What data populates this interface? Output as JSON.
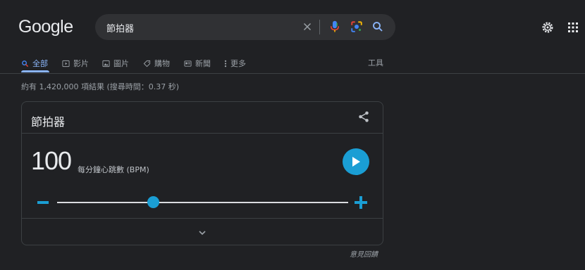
{
  "logo": "Google",
  "search": {
    "query": "節拍器"
  },
  "tabs": [
    {
      "label": "全部",
      "icon": "search-icon",
      "active": true
    },
    {
      "label": "影片",
      "icon": "video-icon"
    },
    {
      "label": "圖片",
      "icon": "image-icon"
    },
    {
      "label": "購物",
      "icon": "tag-icon"
    },
    {
      "label": "新聞",
      "icon": "news-icon"
    },
    {
      "label": "更多",
      "icon": "more-vert-icon"
    }
  ],
  "tools_label": "工具",
  "result_stats": "約有 1,420,000 項結果 (搜尋時間：0.37 秒)",
  "metronome": {
    "title": "節拍器",
    "bpm": "100",
    "bpm_label": "每分鐘心跳數 (BPM)",
    "slider_fraction": 0.33
  },
  "feedback_label": "意見回饋",
  "colors": {
    "accent": "#1a9ed4",
    "link": "#8ab4f8",
    "background": "#202124"
  }
}
